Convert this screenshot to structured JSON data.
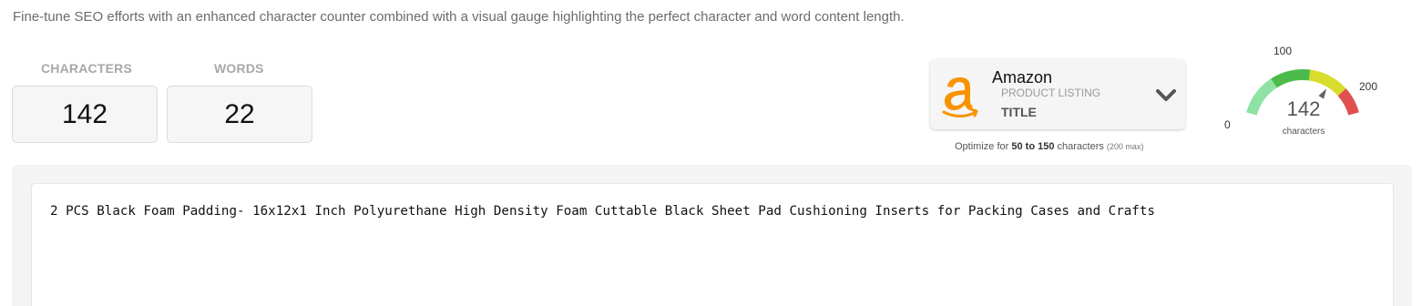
{
  "intro_text": "Fine-tune SEO efforts with an enhanced character counter combined with a visual gauge highlighting the perfect character and word content length.",
  "stats": {
    "characters_label": "CHARACTERS",
    "characters_value": "142",
    "words_label": "WORDS",
    "words_value": "22"
  },
  "platform": {
    "name": "Amazon",
    "type": "PRODUCT LISTING",
    "field": "TITLE",
    "logo_icon": "amazon-logo-icon",
    "chevron_icon": "chevron-down-icon",
    "brand_color": "#f79400"
  },
  "optimize": {
    "prefix": "Optimize for ",
    "range": "50 to 150",
    "suffix": " characters ",
    "max_note": "(200 max)"
  },
  "gauge": {
    "min_label": "0",
    "mid_label": "100",
    "max_label": "200",
    "value": "142",
    "unit": "characters",
    "value_fraction": 0.71,
    "segment_colors": [
      "#8ee3a4",
      "#4cbb4c",
      "#d8dc2a",
      "#e0504f"
    ]
  },
  "editor": {
    "content": "2 PCS Black Foam Padding- 16x12x1 Inch Polyurethane High Density Foam Cuttable Black Sheet Pad Cushioning Inserts for Packing Cases and Crafts"
  }
}
